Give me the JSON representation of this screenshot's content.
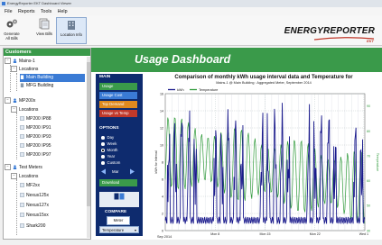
{
  "window": {
    "title": "EnergyReporter EKT Dashboard Viewer"
  },
  "menu": {
    "items": [
      "File",
      "Reports",
      "Tools",
      "Help"
    ]
  },
  "toolbar": {
    "buttons": [
      "Generate All Bills",
      "View Bills",
      "Location Info"
    ]
  },
  "logo": {
    "text": "ENERGYREPORTER",
    "sub": "EKT"
  },
  "sidebar": {
    "header": "Customers",
    "mains_label": "Mains-1",
    "locations_label": "Locations",
    "main_building": "Main Building",
    "mfg_building": "MFG Building",
    "mp200x_label": "MP200x",
    "mp200x_locations": "Locations",
    "mp_items": [
      "MP200 IP88",
      "MP200 IP91",
      "MP200 IP93",
      "MP200 IP95",
      "MP200 IP97"
    ],
    "test_meters_label": "Test Meters",
    "test_locations": "Locations",
    "test_items": [
      "MF2xx",
      "Nexus125x",
      "Nexus127x",
      "Nexus15xx",
      "Shark200"
    ]
  },
  "main": {
    "banner": "Usage Dashboard",
    "panel": {
      "main_header": "MAIN",
      "nav": [
        "Usage",
        "Usage Cost",
        "Top Demand",
        "Usage vs Temp"
      ],
      "options_header": "OPTIONS",
      "options": [
        "Day",
        "Week",
        "Month",
        "Year",
        "Custom"
      ],
      "selected_option": "Month",
      "period": "Mar",
      "download": "Download",
      "compare_header": "COMPARE",
      "meter_button": "Meter",
      "temperature_select": "Temperature"
    }
  },
  "colors": {
    "green": "#3a9a4a",
    "navy": "#0e2b6e",
    "accent": "#3a7bd5",
    "kwh": "#1a1a8c",
    "temp": "#2f9a3a",
    "orange": "#e08a1e",
    "red": "#c0392b"
  },
  "chart_data": {
    "type": "line",
    "title": "Comparison of monthly kWh usage interval data and Temperature for",
    "subtitle": "Mains-1 @ Main Building : Aggregated Meter, September 2014",
    "ylabel": "kWh for Interval",
    "y2label": "Temperature",
    "xlabel_start": "Sep 2014",
    "ylim": [
      0,
      16
    ],
    "y_ticks": [
      "0",
      "2",
      "4",
      "6",
      "8",
      "10",
      "12",
      "14",
      "16"
    ],
    "y2lim": [
      40,
      95
    ],
    "y2_ticks": [
      "40",
      "50",
      "60",
      "70",
      "80",
      "90"
    ],
    "x_ticks": [
      "Mon 8",
      "Mon 15",
      "Mon 22",
      "Wed 1"
    ],
    "grid": true,
    "legend_position": "top-left",
    "series": [
      {
        "name": "kWh",
        "color": "#1a1a8c"
      },
      {
        "name": "Temperature",
        "color": "#2f9a3a"
      }
    ]
  }
}
